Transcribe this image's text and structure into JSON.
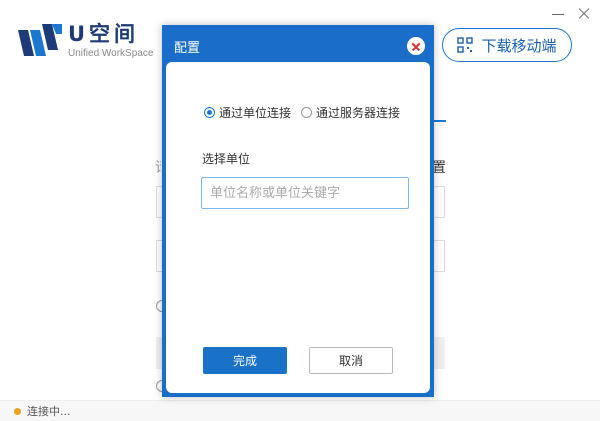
{
  "app": {
    "logo_title": "U空间",
    "logo_subtitle": "Unified WorkSpace",
    "download_label": "下载移动端"
  },
  "background": {
    "right_label": "置",
    "left_label": "请"
  },
  "status": {
    "text": "连接中..."
  },
  "dialog": {
    "title": "配置",
    "connect_options": [
      {
        "label": "通过单位连接",
        "checked": true
      },
      {
        "label": "通过服务器连接",
        "checked": false
      }
    ],
    "select_label": "选择单位",
    "unit_input": {
      "value": "",
      "placeholder": "单位名称或单位关键字"
    },
    "confirm_label": "完成",
    "cancel_label": "取消"
  },
  "colors": {
    "accent": "#1a6dc8",
    "status_dot": "#f0a020",
    "close_x": "#e03030"
  }
}
